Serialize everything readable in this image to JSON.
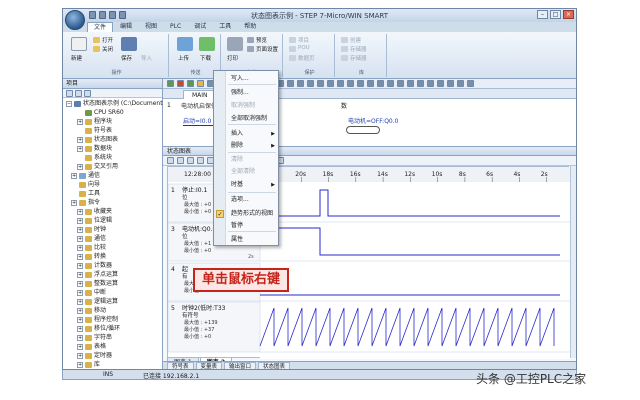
{
  "window": {
    "title": "状态图表示例 - STEP 7-Micro/WIN SMART"
  },
  "menu_tabs": [
    "文件",
    "编辑",
    "视图",
    "PLC",
    "调试",
    "工具",
    "帮助"
  ],
  "ribbon": {
    "groups": [
      {
        "caption": "操作",
        "items": [
          "新建",
          "打开",
          "关闭",
          "保存"
        ]
      },
      {
        "caption": "传送",
        "items": [
          "上传",
          "下载"
        ]
      },
      {
        "caption": "打印",
        "items": [
          "打印",
          "预览",
          "页面设置"
        ]
      },
      {
        "caption": "保护",
        "items": [
          "项目",
          "POU",
          "数据页"
        ]
      },
      {
        "caption": "库",
        "items": [
          "创建",
          "存储器",
          "存储器"
        ]
      }
    ],
    "import_label": "导入"
  },
  "project_tree": {
    "header": "项目",
    "root": "状态图表示例 (C:\\Documents o",
    "items": [
      "CPU SR60",
      "程序块",
      "符号表",
      "状态图表",
      "数据块",
      "系统块",
      "交叉引用",
      "通信",
      "向导",
      "工具",
      "指令",
      "收藏夹",
      "位逻辑",
      "时钟",
      "通信",
      "比较",
      "转换",
      "计数器",
      "浮点运算",
      "整数运算",
      "中断",
      "逻辑运算",
      "移动",
      "程序控制",
      "移位/循环",
      "字符串",
      "表格",
      "定时器",
      "库",
      "调用子例程"
    ]
  },
  "editor": {
    "tab": "MAIN",
    "network_num": "1",
    "comment": "电动机启保停",
    "contact1": "启动=I0.0",
    "coil_label": "电动机=Q0.0",
    "coil_right": "电动机=OFF:Q0.0",
    "mid_label": "数"
  },
  "status_chart": {
    "header": "状态图表",
    "time_label": "12:28:00",
    "time_ticks": [
      "2s",
      "20s",
      "18s",
      "16s",
      "14s",
      "12s",
      "10s",
      "8s",
      "6s",
      "4s",
      "2s"
    ],
    "lanes": [
      {
        "idx": "1",
        "name": "停止:I0.1",
        "sub": "位",
        "lines": [
          "最大值 : +0",
          "最小值 : +0"
        ],
        "low": "2s"
      },
      {
        "idx": "3",
        "name": "电动机:Q0.0",
        "sub": "位",
        "lines": [
          "最大值 : +1",
          "最小值 : +0"
        ],
        "low": "2s"
      },
      {
        "idx": "4",
        "name": "起",
        "sub": "有",
        "lines": [
          "最大值 : +0",
          "最小值 : +0"
        ],
        "low": ""
      },
      {
        "idx": "5",
        "name": "时钟2(低时:T33",
        "sub": "有符号",
        "lines": [
          "最大值 : +139",
          "最小值 : +37",
          "最小值 : +0"
        ],
        "low": ""
      }
    ],
    "tabs": [
      "图表 1",
      "图表 2"
    ],
    "active_tab": 1
  },
  "context_menu": {
    "items": [
      {
        "label": "写入...",
        "disabled": false,
        "arrow": false
      },
      {
        "label": "强制...",
        "disabled": false,
        "arrow": false
      },
      {
        "label": "取消强制",
        "disabled": true,
        "arrow": false
      },
      {
        "label": "全部取消强制",
        "disabled": false,
        "arrow": false
      },
      {
        "label": "插入",
        "disabled": false,
        "arrow": true
      },
      {
        "label": "删除",
        "disabled": false,
        "arrow": true
      },
      {
        "label": "清除",
        "disabled": true,
        "arrow": false
      },
      {
        "label": "全部清除",
        "disabled": true,
        "arrow": false
      },
      {
        "label": "时基",
        "disabled": false,
        "arrow": true
      },
      {
        "label": "选项...",
        "disabled": false,
        "arrow": false
      },
      {
        "label": "趋势形式的视图",
        "disabled": false,
        "arrow": false,
        "checked": true
      },
      {
        "label": "暂停",
        "disabled": false,
        "arrow": false
      },
      {
        "label": "属性",
        "disabled": false,
        "arrow": false
      }
    ]
  },
  "bottom_tabs": [
    "符号表",
    "变量表",
    "输出窗口",
    "状态图表"
  ],
  "status_bar": {
    "left": "INS",
    "mid": "已连接 192.168.2.1"
  },
  "annotation": "单击鼠标右键",
  "watermark": "头条 @工控PLC之家",
  "colors": {
    "accent": "#2b5a8e",
    "trace": "#2a2acc",
    "callout": "#c6251c"
  }
}
